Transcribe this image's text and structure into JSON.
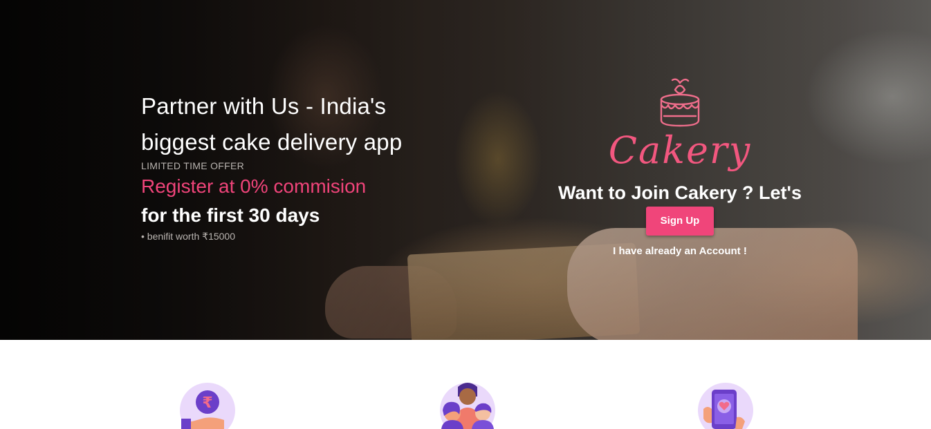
{
  "hero": {
    "headline_line1": "Partner with Us - India's",
    "headline_line2": "biggest cake delivery app",
    "offer_tag": "LIMITED TIME OFFER",
    "highlight": "Register at 0% commision",
    "subline": "for the first 30 days",
    "benefit": "• benifit worth ₹15000"
  },
  "brand": {
    "name": "Cakery",
    "logo_icon": "cake-icon",
    "join_text": "Want to Join Cakery ? Let's",
    "signup_label": "Sign Up",
    "login_link": "I have already an Account !"
  },
  "features": {
    "icons": [
      "rupee-hand-icon",
      "people-group-icon",
      "phone-heart-icon"
    ]
  },
  "colors": {
    "accent": "#f0457a",
    "brand_logo": "#f2577f",
    "icon_circle": "#ead9fb",
    "icon_purple": "#6b3fc9"
  }
}
